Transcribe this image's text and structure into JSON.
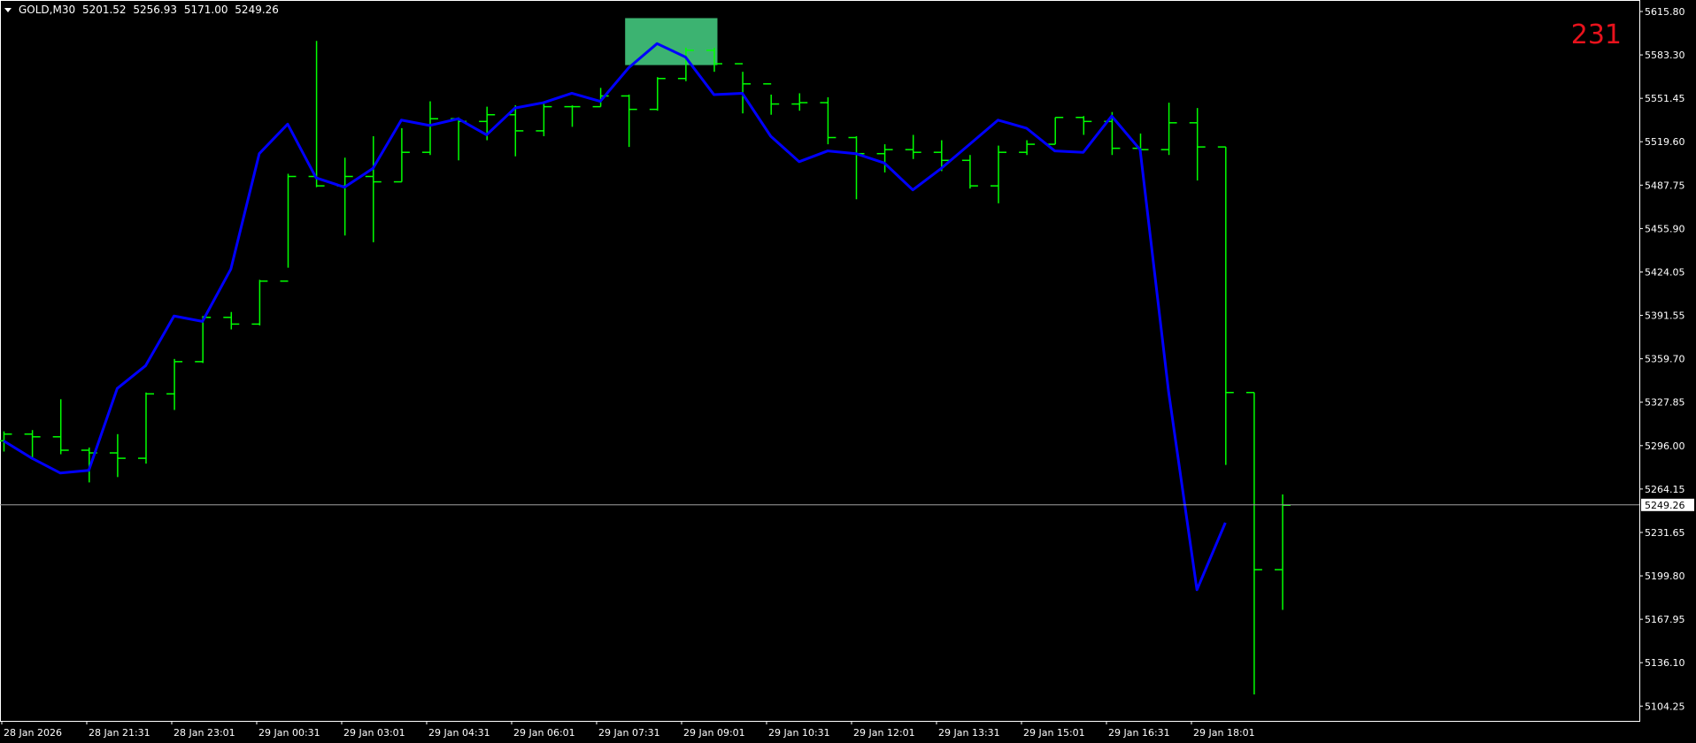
{
  "header": {
    "symbol": "GOLD,M30",
    "open": "5201.52",
    "high": "5256.93",
    "low": "5171.00",
    "close": "5249.26"
  },
  "counter": "231",
  "colors": {
    "background": "#000000",
    "axis": "#ffffff",
    "bar": "#00ff00",
    "line": "#0000ff",
    "highlight": "#3cb371",
    "counter": "#e8121c",
    "price_line": "#a0a0a0"
  },
  "chart_data": {
    "type": "ohlc",
    "symbol": "GOLD,M30",
    "ylim": [
      5088.3,
      5625.5
    ],
    "y_ticks": [
      "5615.80",
      "5583.30",
      "5551.45",
      "5519.60",
      "5487.75",
      "5455.90",
      "5424.05",
      "5391.55",
      "5359.70",
      "5327.85",
      "5296.00",
      "5264.15",
      "5231.65",
      "5199.80",
      "5167.95",
      "5136.10",
      "5104.25"
    ],
    "x_labels": [
      "28 Jan 2026",
      "28 Jan 21:31",
      "28 Jan 23:01",
      "29 Jan 00:31",
      "29 Jan 03:01",
      "29 Jan 04:31",
      "29 Jan 06:01",
      "29 Jan 07:31",
      "29 Jan 09:01",
      "29 Jan 10:31",
      "29 Jan 12:01",
      "29 Jan 13:31",
      "29 Jan 15:01",
      "29 Jan 16:31",
      "29 Jan 18:01"
    ],
    "current_price": "5249.26",
    "bars": [
      {
        "o": 5297,
        "h": 5304,
        "l": 5289,
        "c": 5302
      },
      {
        "o": 5302,
        "h": 5305,
        "l": 5283,
        "c": 5300
      },
      {
        "o": 5300,
        "h": 5328,
        "l": 5287,
        "c": 5290
      },
      {
        "o": 5290,
        "h": 5292,
        "l": 5266,
        "c": 5288
      },
      {
        "o": 5288,
        "h": 5302,
        "l": 5270,
        "c": 5284
      },
      {
        "o": 5284,
        "h": 5333,
        "l": 5280,
        "c": 5332
      },
      {
        "o": 5332,
        "h": 5358,
        "l": 5320,
        "c": 5356
      },
      {
        "o": 5356,
        "h": 5390,
        "l": 5355,
        "c": 5389
      },
      {
        "o": 5389,
        "h": 5393,
        "l": 5380,
        "c": 5384
      },
      {
        "o": 5384,
        "h": 5417,
        "l": 5383,
        "c": 5416
      },
      {
        "o": 5416,
        "h": 5496,
        "l": 5426,
        "c": 5494
      },
      {
        "o": 5494,
        "h": 5595,
        "l": 5486,
        "c": 5487
      },
      {
        "o": 5487,
        "h": 5508,
        "l": 5450,
        "c": 5494
      },
      {
        "o": 5494,
        "h": 5524,
        "l": 5445,
        "c": 5490
      },
      {
        "o": 5490,
        "h": 5530,
        "l": 5490,
        "c": 5512
      },
      {
        "o": 5512,
        "h": 5550,
        "l": 5510,
        "c": 5537
      },
      {
        "o": 5537,
        "h": 5538,
        "l": 5506,
        "c": 5535
      },
      {
        "o": 5535,
        "h": 5546,
        "l": 5521,
        "c": 5540
      },
      {
        "o": 5540,
        "h": 5547,
        "l": 5509,
        "c": 5528
      },
      {
        "o": 5528,
        "h": 5548,
        "l": 5524,
        "c": 5546
      },
      {
        "o": 5546,
        "h": 5547,
        "l": 5531,
        "c": 5546
      },
      {
        "o": 5546,
        "h": 5560,
        "l": 5546,
        "c": 5554
      },
      {
        "o": 5554,
        "h": 5555,
        "l": 5516,
        "c": 5544
      },
      {
        "o": 5544,
        "h": 5568,
        "l": 5543,
        "c": 5567
      },
      {
        "o": 5567,
        "h": 5590,
        "l": 5565,
        "c": 5588
      },
      {
        "o": 5588,
        "h": 5590,
        "l": 5572,
        "c": 5578
      },
      {
        "o": 5578,
        "h": 5572,
        "l": 5541,
        "c": 5563
      },
      {
        "o": 5563,
        "h": 5555,
        "l": 5540,
        "c": 5548
      },
      {
        "o": 5548,
        "h": 5556,
        "l": 5543,
        "c": 5549
      },
      {
        "o": 5549,
        "h": 5553,
        "l": 5518,
        "c": 5523
      },
      {
        "o": 5523,
        "h": 5524,
        "l": 5477,
        "c": 5511
      },
      {
        "o": 5511,
        "h": 5518,
        "l": 5497,
        "c": 5514
      },
      {
        "o": 5514,
        "h": 5525,
        "l": 5507,
        "c": 5512
      },
      {
        "o": 5512,
        "h": 5521,
        "l": 5498,
        "c": 5506
      },
      {
        "o": 5506,
        "h": 5510,
        "l": 5485,
        "c": 5487
      },
      {
        "o": 5487,
        "h": 5517,
        "l": 5474,
        "c": 5512
      },
      {
        "o": 5512,
        "h": 5521,
        "l": 5510,
        "c": 5518
      },
      {
        "o": 5518,
        "h": 5538,
        "l": 5518,
        "c": 5538
      },
      {
        "o": 5538,
        "h": 5539,
        "l": 5525,
        "c": 5535
      },
      {
        "o": 5535,
        "h": 5542,
        "l": 5510,
        "c": 5515
      },
      {
        "o": 5515,
        "h": 5526,
        "l": 5510,
        "c": 5514
      },
      {
        "o": 5514,
        "h": 5549,
        "l": 5510,
        "c": 5534
      },
      {
        "o": 5534,
        "h": 5545,
        "l": 5491,
        "c": 5516
      },
      {
        "o": 5516,
        "h": 5516,
        "l": 5279,
        "c": 5333
      },
      {
        "o": 5333,
        "h": 5333,
        "l": 5108,
        "c": 5201
      },
      {
        "o": 5201,
        "h": 5257,
        "l": 5171,
        "c": 5249
      }
    ],
    "line": [
      5297,
      5284,
      5273,
      5275,
      5336,
      5353,
      5390,
      5386,
      5425,
      5511,
      5533,
      5493,
      5486,
      5500,
      5536,
      5532,
      5537,
      5525,
      5545,
      5549,
      5556,
      5550,
      5575,
      5593,
      5583,
      5555,
      5556,
      5524,
      5505,
      5513,
      5511,
      5504,
      5484,
      5500,
      5518,
      5536,
      5530,
      5513,
      5512,
      5539,
      5514,
      5334,
      5186,
      5236
    ],
    "highlight_zone": {
      "bar_from": 22,
      "bar_to": 25,
      "y_top": 5612,
      "y_bottom": 5577
    }
  }
}
